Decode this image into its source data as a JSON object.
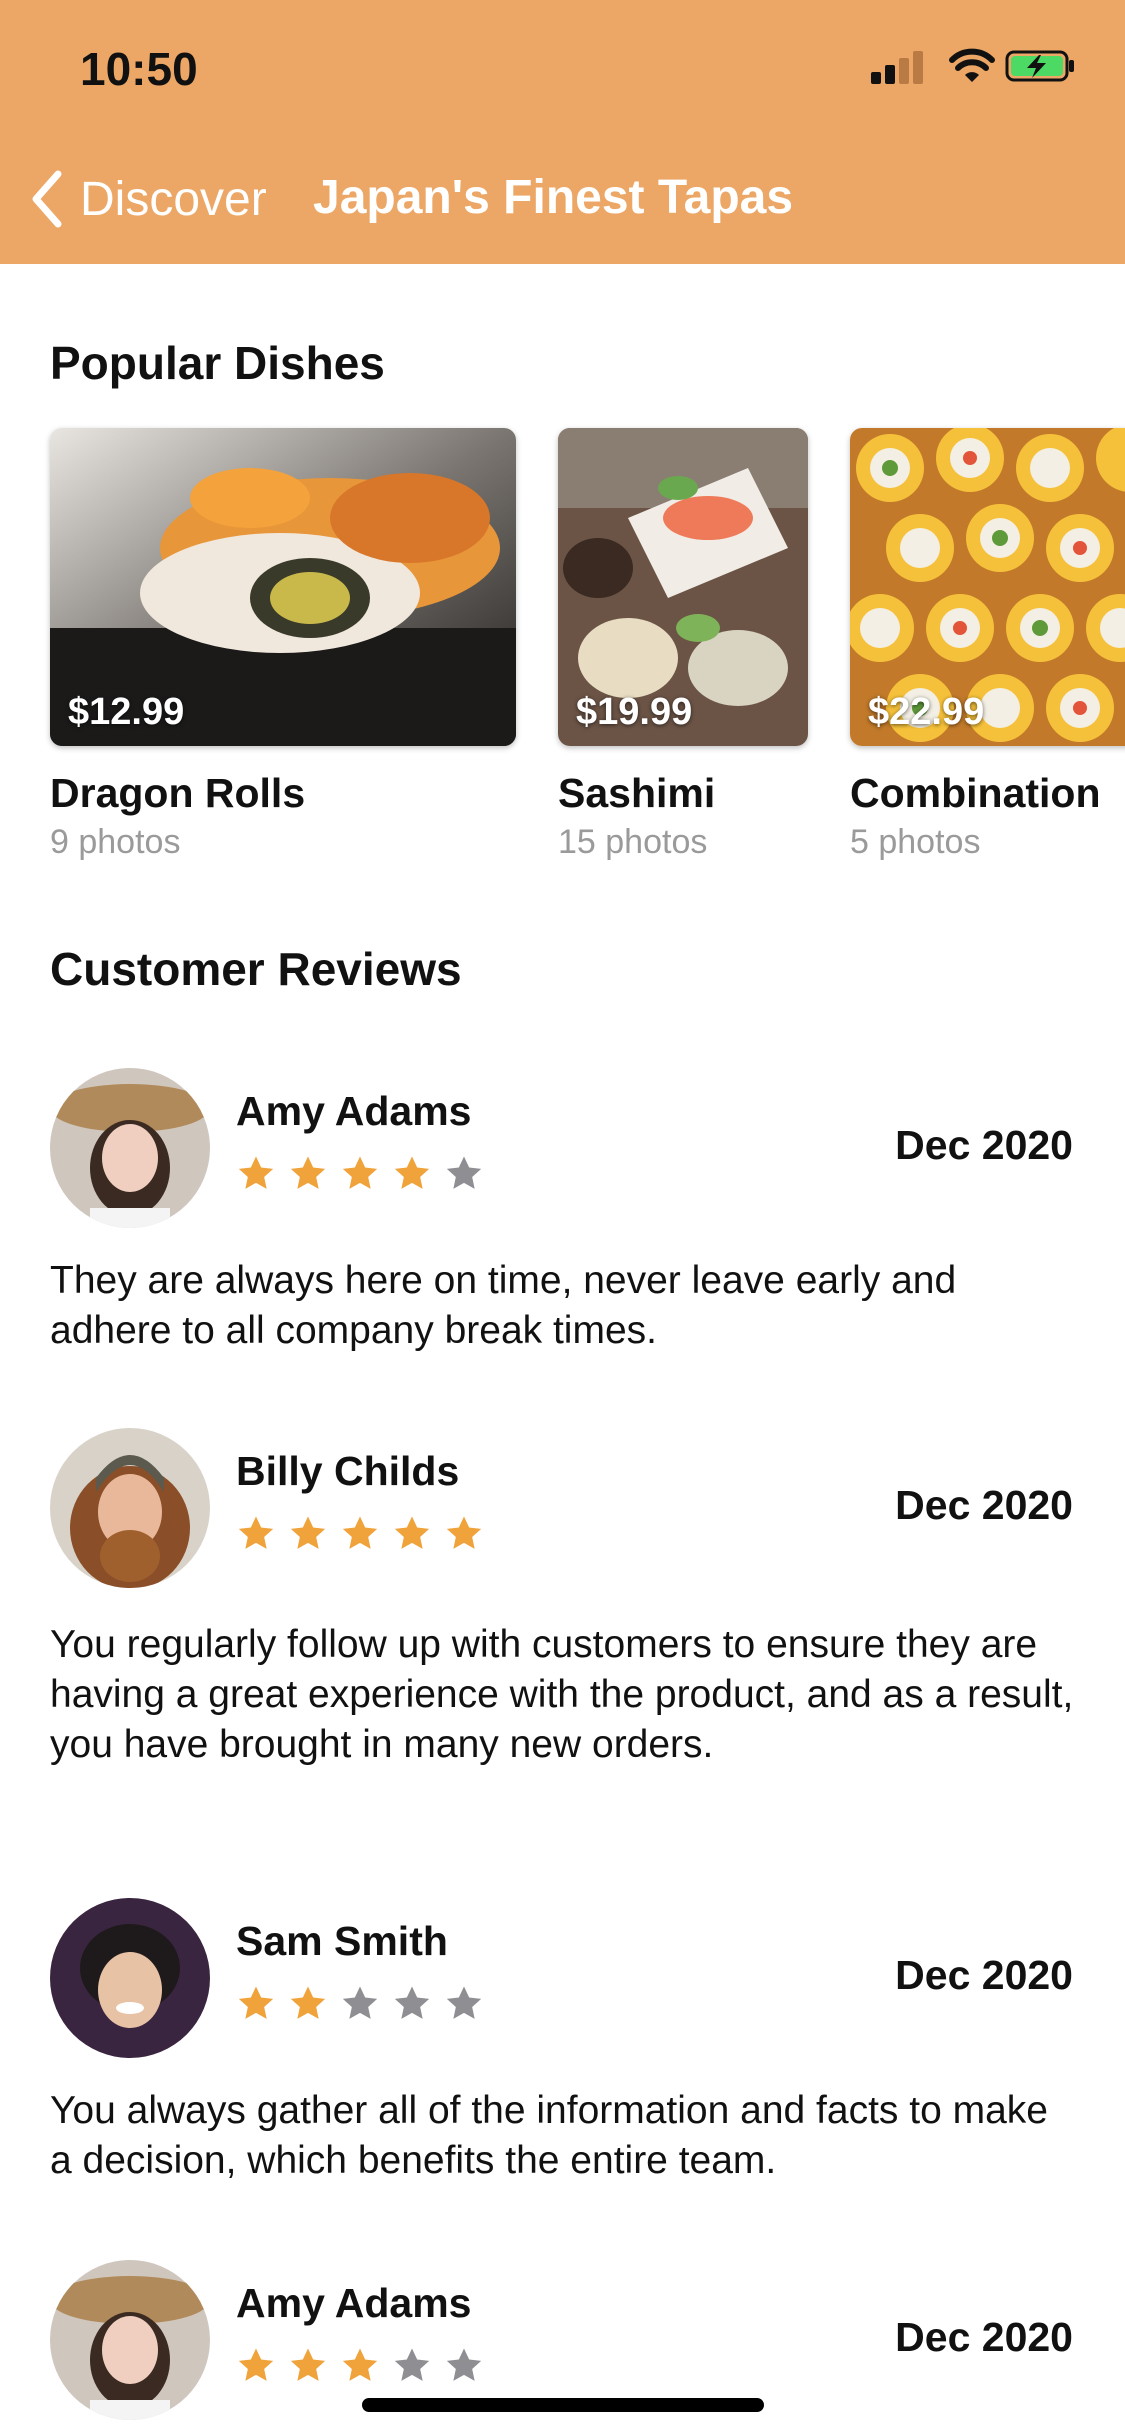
{
  "status": {
    "time": "10:50"
  },
  "nav": {
    "back_label": "Discover",
    "title": "Japan's Finest Tapas"
  },
  "popular": {
    "title": "Popular Dishes",
    "dishes": [
      {
        "name": "Dragon Rolls",
        "price": "$12.99",
        "photos": "9 photos"
      },
      {
        "name": "Sashimi",
        "price": "$19.99",
        "photos": "15 photos"
      },
      {
        "name": "Combination",
        "price": "$22.99",
        "photos": "5 photos"
      }
    ]
  },
  "reviews": {
    "title": "Customer Reviews",
    "items": [
      {
        "name": "Amy Adams",
        "date": "Dec 2020",
        "rating": 4,
        "text": "They are always here on time, never leave early and adhere to all company break times."
      },
      {
        "name": "Billy Childs",
        "date": "Dec 2020",
        "rating": 5,
        "text": "You regularly follow up with customers to ensure they are having a great experience with the product, and as a result, you have brought in many new orders."
      },
      {
        "name": "Sam Smith",
        "date": "Dec 2020",
        "rating": 2,
        "text": "You always gather all of the information and facts to make a decision, which benefits the entire team."
      },
      {
        "name": "Amy Adams",
        "date": "Dec 2020",
        "rating": 3,
        "text": ""
      }
    ]
  },
  "colors": {
    "header": "#eca766",
    "star_on": "#f0a33a",
    "star_off": "#8e8e93"
  }
}
